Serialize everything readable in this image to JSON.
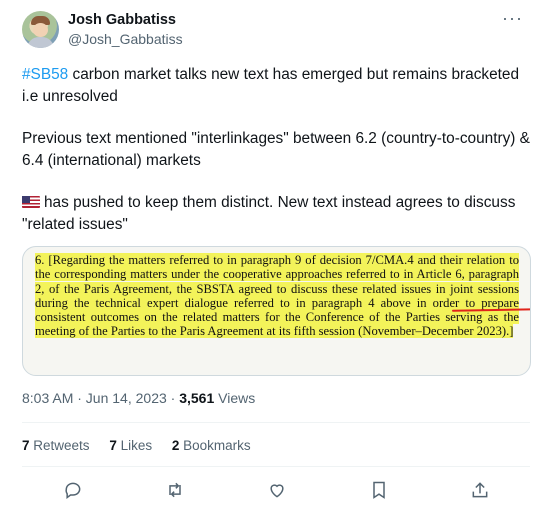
{
  "author": {
    "name": "Josh Gabbatiss",
    "handle": "@Josh_Gabbatiss"
  },
  "more_label": "···",
  "tweet": {
    "p1_hashtag": "#SB58",
    "p1_text": " carbon market talks new text has emerged but remains bracketed i.e unresolved",
    "p2": "Previous text mentioned \"interlinkages\" between 6.2 (country-to-country) & 6.4 (international) markets",
    "p3": "has pushed to keep them distinct. New text instead agrees to discuss \"related issues\""
  },
  "document": {
    "text": "6.       [Regarding the matters referred to in paragraph 9 of decision 7/CMA.4 and their relation to the corresponding matters under the cooperative approaches referred to in Article 6, paragraph 2, of the Paris Agreement, the SBSTA agreed to discuss these related issues in joint sessions during the technical expert dialogue referred to in paragraph 4 above in order to prepare consistent outcomes on the related matters for the Conference of the Parties serving as the meeting of the Parties to the Paris Agreement at its fifth session (November–December 2023).]"
  },
  "meta": {
    "time": "8:03 AM · Jun 14, 2023 · ",
    "views_count": "3,561",
    "views_label": " Views"
  },
  "stats": {
    "retweets_count": "7",
    "retweets_label": " Retweets",
    "likes_count": "7",
    "likes_label": " Likes",
    "bookmarks_count": "2",
    "bookmarks_label": " Bookmarks"
  },
  "icons": [
    "reply-icon",
    "retweet-icon",
    "like-icon",
    "bookmark-icon",
    "share-icon"
  ],
  "colors": {
    "link": "#1d9bf0",
    "highlight": "#f3f35a",
    "underline": "#e0241b",
    "secondary": "#536471"
  }
}
